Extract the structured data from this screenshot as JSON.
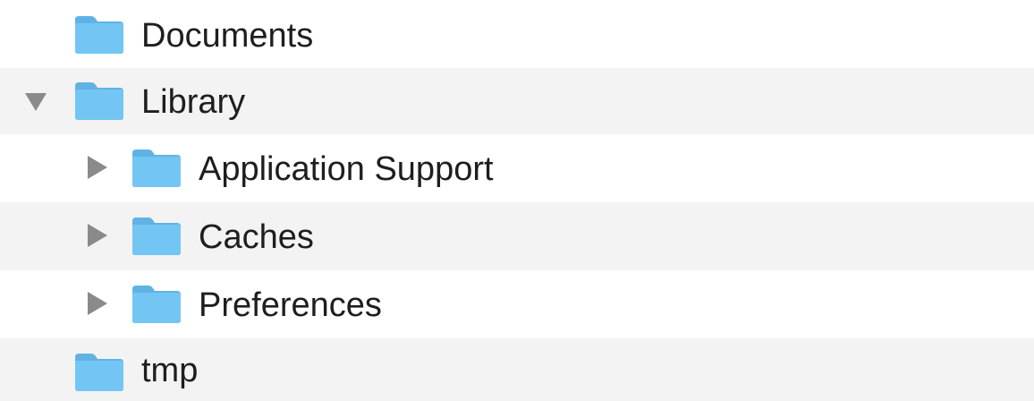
{
  "tree": {
    "items": [
      {
        "label": "Documents",
        "expanded": null,
        "level": 0,
        "striped": false
      },
      {
        "label": "Library",
        "expanded": true,
        "level": 0,
        "striped": true
      },
      {
        "label": "Application Support",
        "expanded": false,
        "level": 1,
        "striped": false
      },
      {
        "label": "Caches",
        "expanded": false,
        "level": 1,
        "striped": true
      },
      {
        "label": "Preferences",
        "expanded": false,
        "level": 1,
        "striped": false
      },
      {
        "label": "tmp",
        "expanded": null,
        "level": 0,
        "striped": true
      }
    ]
  },
  "colors": {
    "stripe": "#f3f3f3",
    "folder_front": "#73c6f4",
    "folder_back": "#5fb3e4",
    "disclosure": "#8a8a8a",
    "text": "#1e1e1e"
  },
  "icons": {
    "folder": "folder-icon",
    "expanded": "disclosure-triangle-down-icon",
    "collapsed": "disclosure-triangle-right-icon"
  }
}
